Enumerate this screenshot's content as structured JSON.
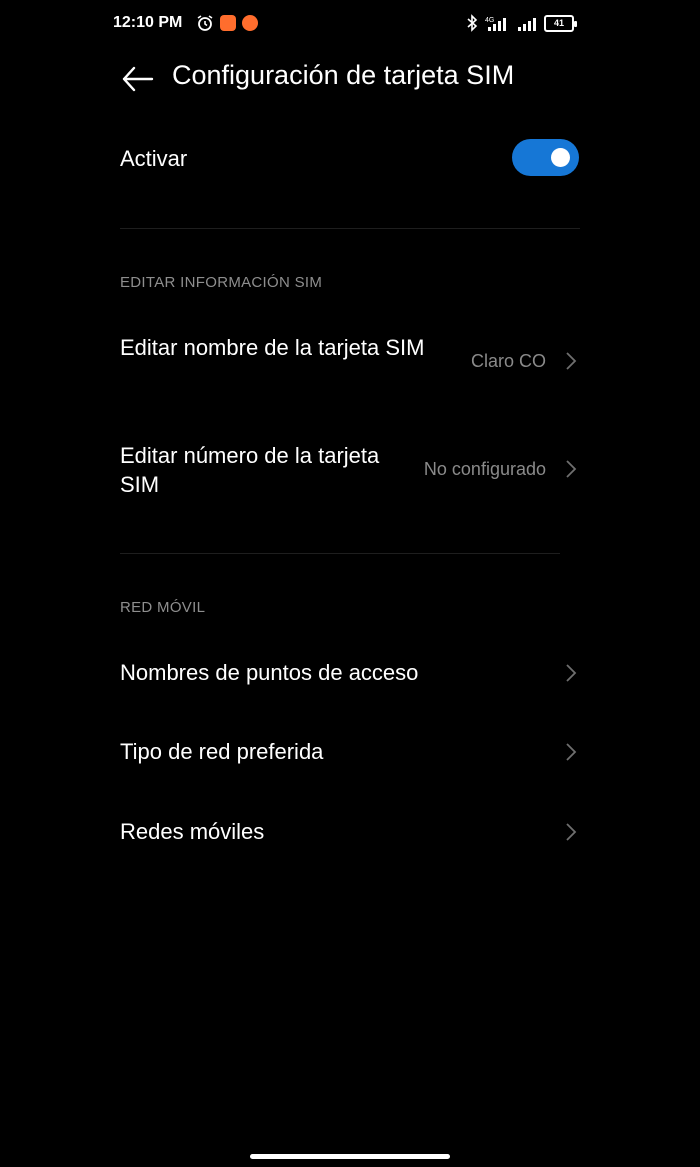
{
  "status_bar": {
    "time": "12:10 PM",
    "battery": "41",
    "network_type": "4G",
    "icons": [
      "alarm-icon",
      "app-notification-icon",
      "bluetooth-icon",
      "signal-icon",
      "battery-icon"
    ],
    "notification_color": "#ff6d2d"
  },
  "header": {
    "title": "Configuración de tarjeta SIM"
  },
  "activate": {
    "label": "Activar",
    "enabled": true,
    "accent_color": "#1677d6"
  },
  "sections": {
    "edit_sim": {
      "title": "EDITAR INFORMACIÓN SIM",
      "name_label": "Editar nombre de la tarjeta SIM",
      "name_value": "Claro CO",
      "number_label": "Editar número de la tarjeta SIM",
      "number_value": "No configurado"
    },
    "mobile": {
      "title": "RED MÓVIL",
      "items": [
        {
          "label": "Nombres de puntos de acceso"
        },
        {
          "label": "Tipo de red preferida"
        },
        {
          "label": "Redes móviles"
        }
      ]
    }
  }
}
